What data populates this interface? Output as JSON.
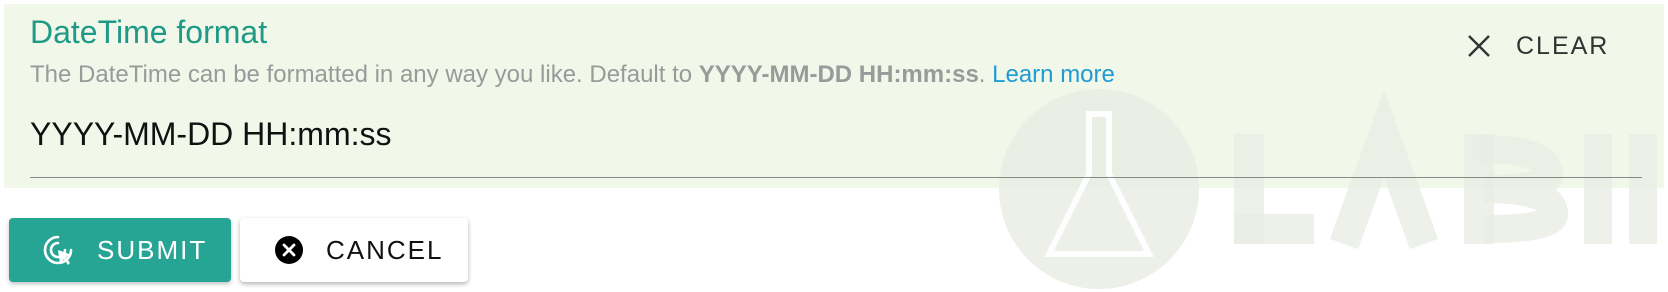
{
  "field": {
    "title": "DateTime format",
    "helper_prefix": "The DateTime can be formatted in any way you like. Default to ",
    "helper_format": "YYYY-MM-DD HH:mm:ss",
    "helper_suffix": ". ",
    "learn_more": "Learn more",
    "value": "YYYY-MM-DD HH:mm:ss",
    "clear_label": "CLEAR",
    "clear_icon": "close-icon"
  },
  "actions": {
    "submit_label": "SUBMIT",
    "submit_icon": "cursor-click-icon",
    "cancel_label": "CANCEL",
    "cancel_icon": "cancel-circle-icon"
  },
  "colors": {
    "panel_background": "#f1f7e9",
    "title": "#1e9a86",
    "link": "#1f9bd6",
    "submit_background": "#27a594",
    "cancel_background": "#ffffff"
  }
}
